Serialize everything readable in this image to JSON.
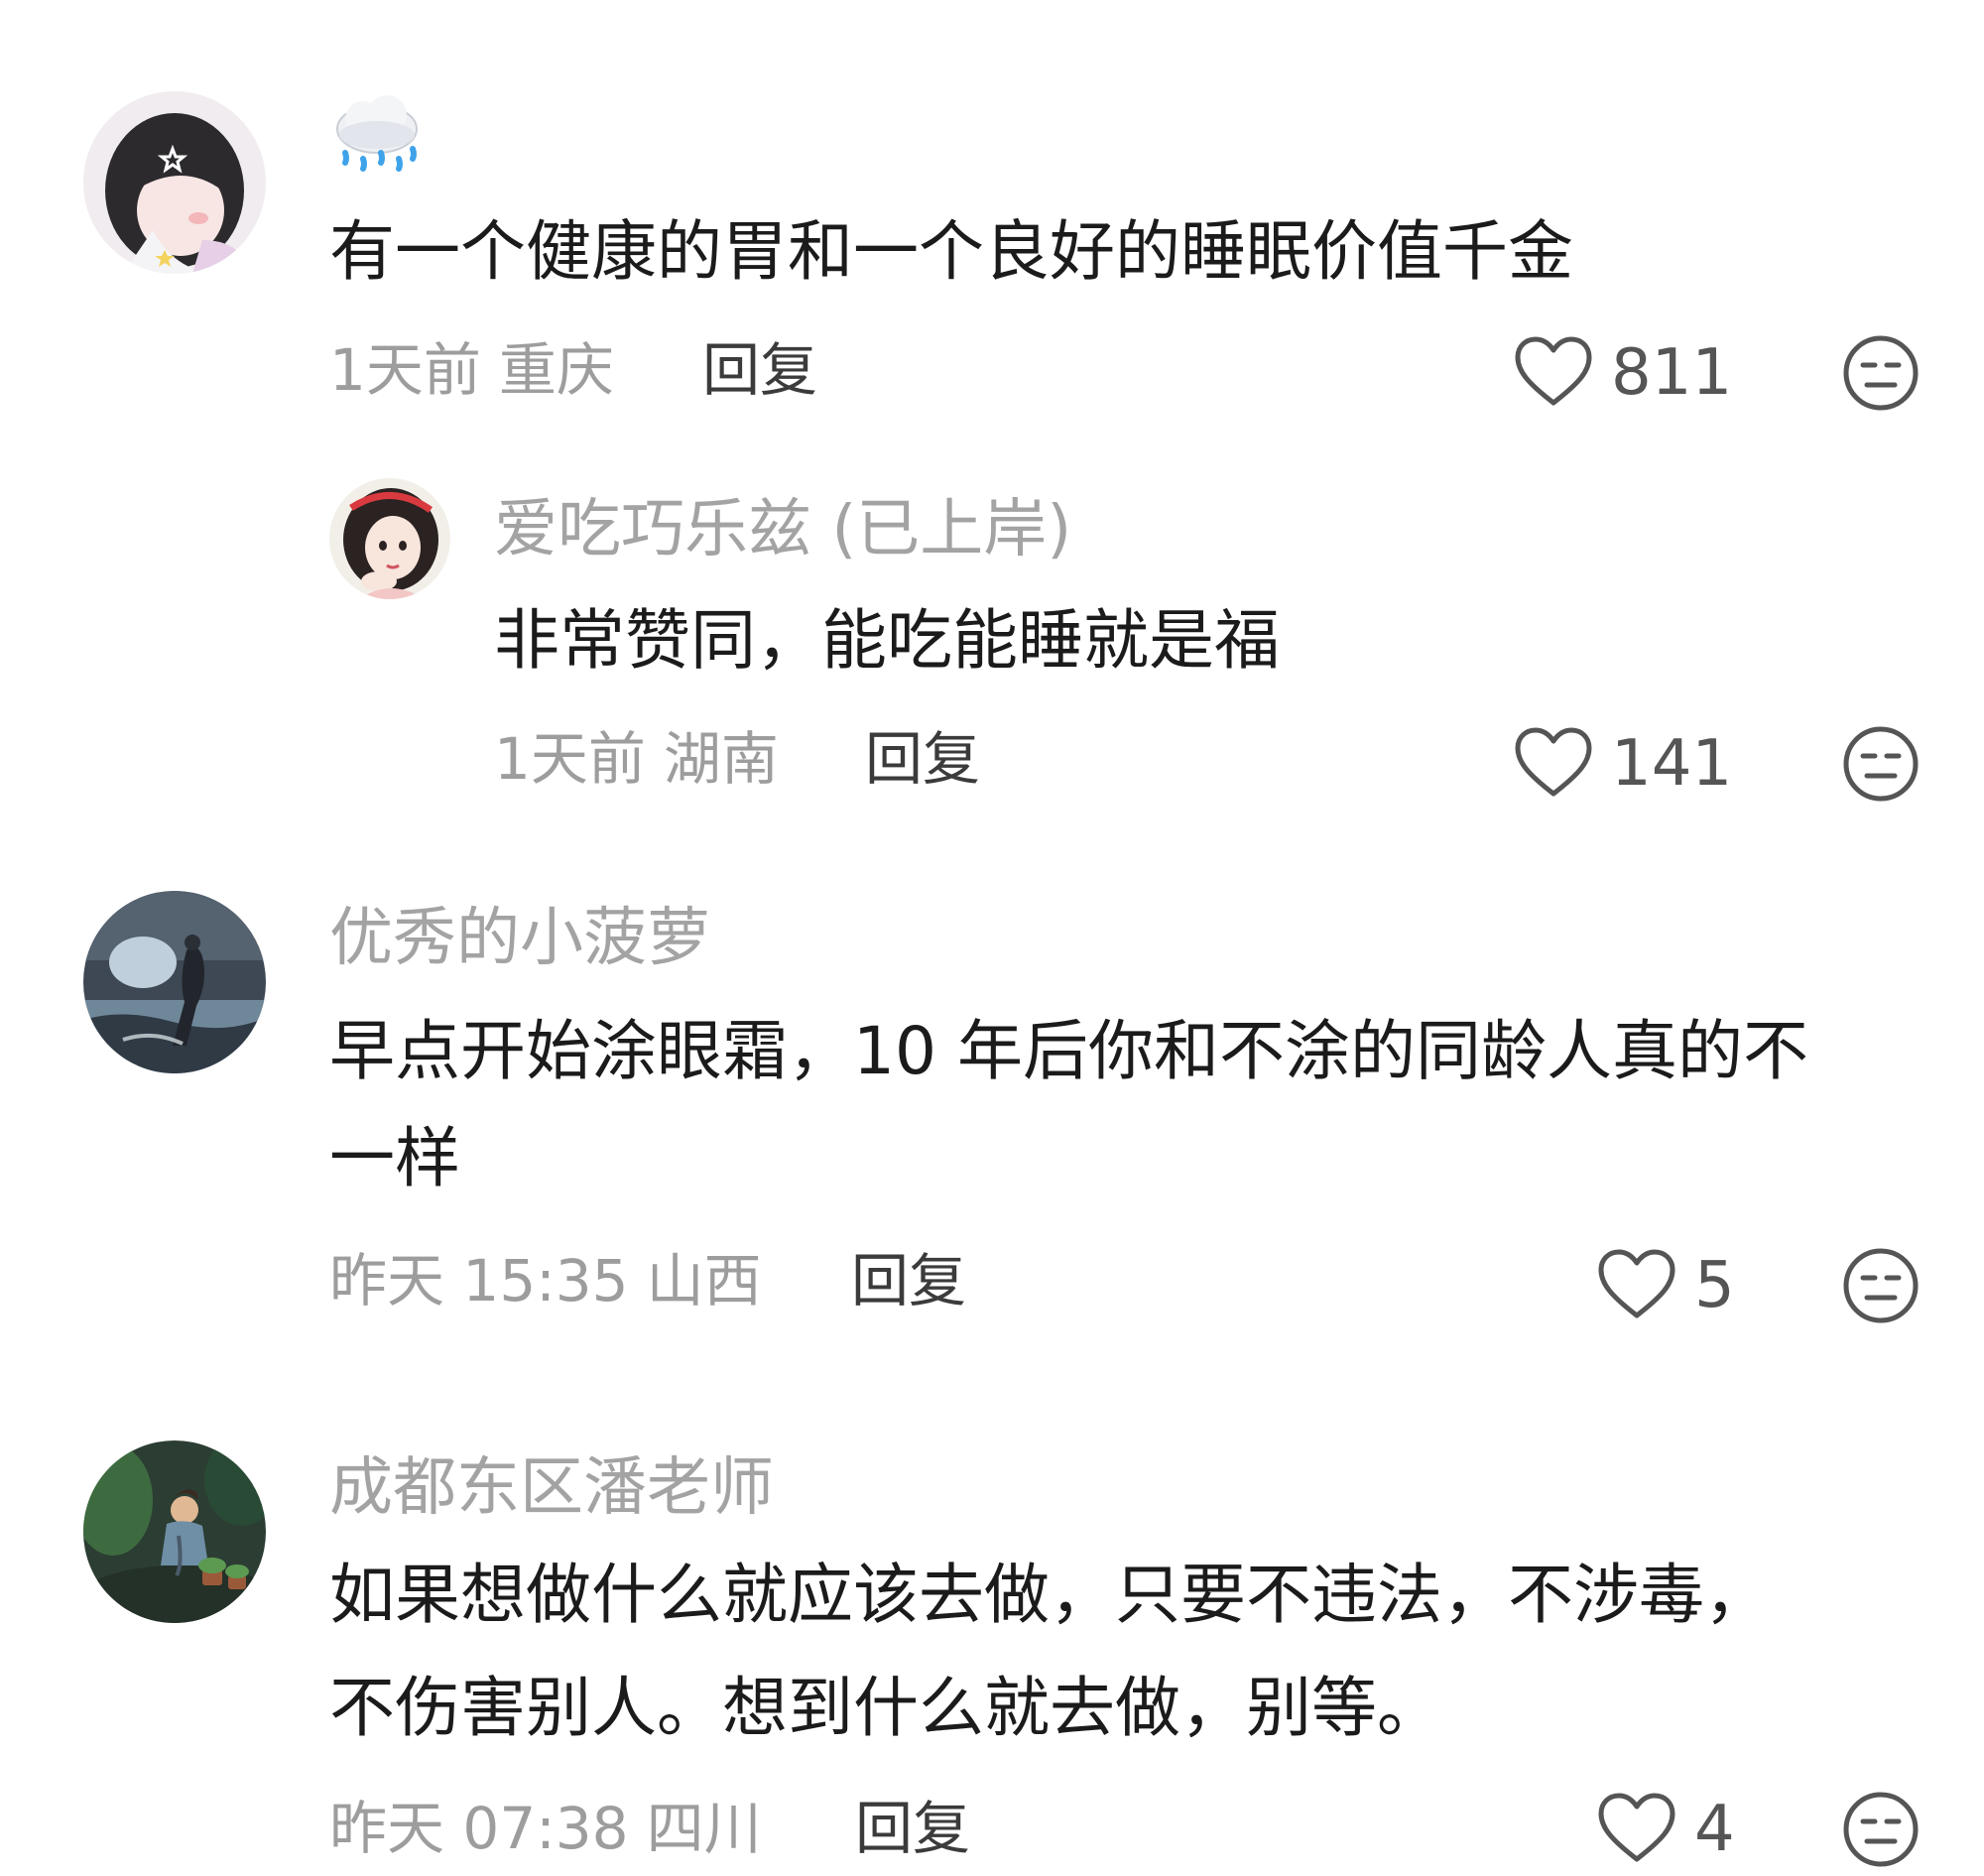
{
  "colors": {
    "text": "#1b1b1b",
    "username": "#a3a3a3",
    "meta": "#9d9d9d",
    "reply": "#3b3b3b",
    "icon": "#555555"
  },
  "comments": [
    {
      "username_emoji": "🌧️",
      "text": "有一个健康的胃和一个良好的睡眠价值千金",
      "time": "1天前",
      "location": "重庆",
      "reply_label": "回复",
      "likes": "811",
      "replies": [
        {
          "username": "爱吃巧乐兹 (已上岸)",
          "text": "非常赞同，能吃能睡就是福",
          "time": "1天前",
          "location": "湖南",
          "reply_label": "回复",
          "likes": "141"
        }
      ]
    },
    {
      "username": "优秀的小菠萝",
      "text_lines": [
        "早点开始涂眼霜，10 年后你和不涂的同龄人真的不",
        "一样"
      ],
      "time": "昨天 15:35",
      "location": "山西",
      "reply_label": "回复",
      "likes": "5"
    },
    {
      "username": "成都东区潘老师",
      "text_lines": [
        "如果想做什么就应该去做，只要不违法，不涉毒，",
        "不伤害别人。想到什么就去做，别等。"
      ],
      "time": "昨天 07:38",
      "location": "四川",
      "reply_label": "回复",
      "likes": "4"
    }
  ]
}
